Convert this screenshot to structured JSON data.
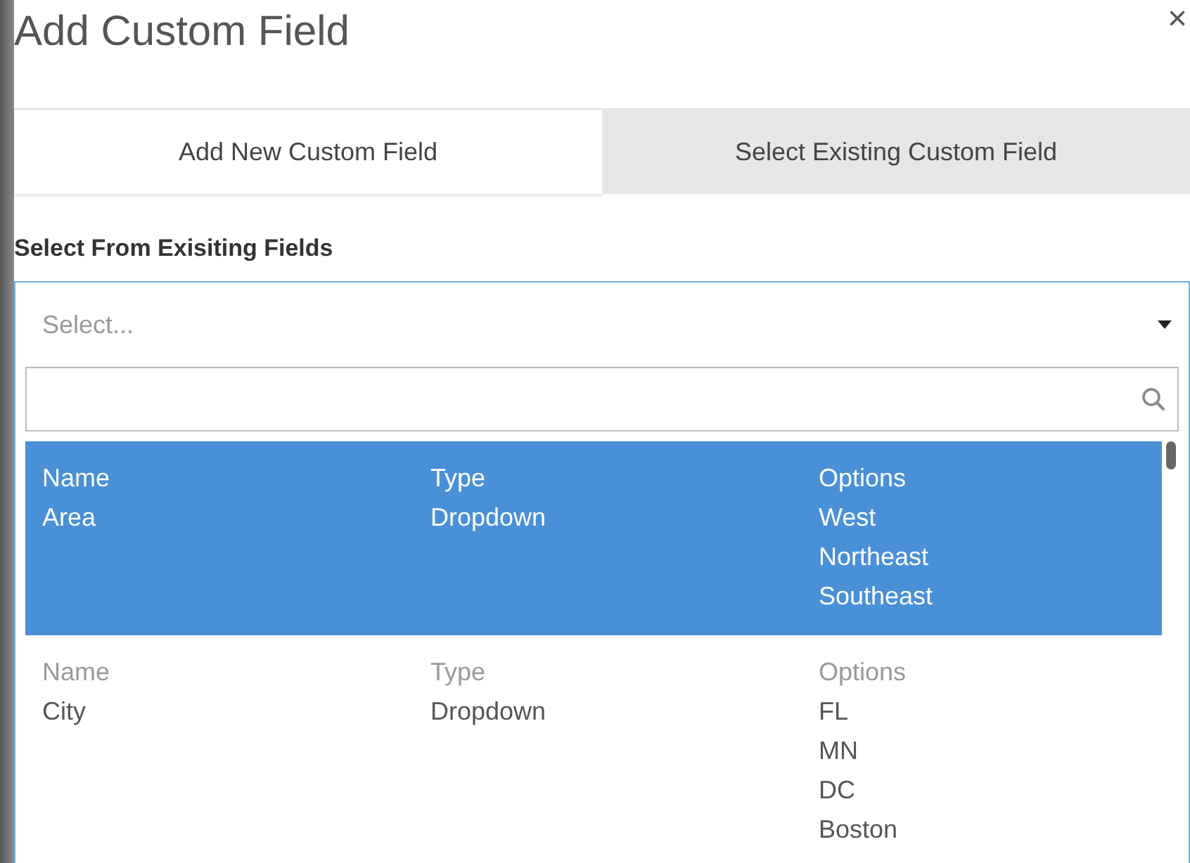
{
  "dialog": {
    "title": "Add Custom Field",
    "close": "×"
  },
  "tabs": [
    {
      "label": "Add New Custom Field",
      "selected": true
    },
    {
      "label": "Select Existing Custom Field",
      "selected": false
    }
  ],
  "field_label": "Select From Exisiting Fields",
  "dropdown": {
    "placeholder": "Select...",
    "expanded": true
  },
  "rows": [
    {
      "selected": true,
      "name_label": "Name",
      "name": "Area",
      "type_label": "Type",
      "type": "Dropdown",
      "options_label": "Options",
      "options": [
        "West",
        "Northeast",
        "Southeast"
      ]
    },
    {
      "selected": false,
      "name_label": "Name",
      "name": "City",
      "type_label": "Type",
      "type": "Dropdown",
      "options_label": "Options",
      "options": [
        "FL",
        "MN",
        "DC",
        "Boston"
      ]
    }
  ]
}
